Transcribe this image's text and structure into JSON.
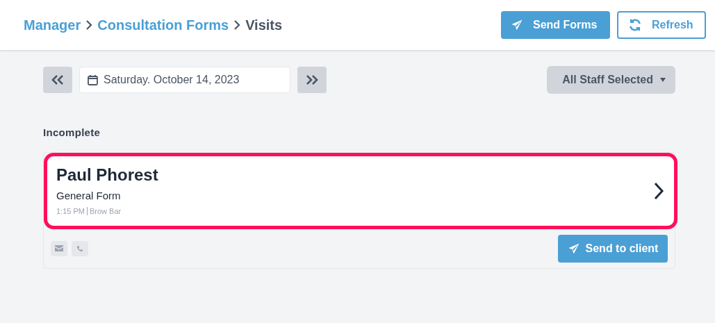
{
  "breadcrumb": [
    {
      "label": "Manager",
      "current": false
    },
    {
      "label": "Consultation Forms",
      "current": false
    },
    {
      "label": "Visits",
      "current": true
    }
  ],
  "header_buttons": [
    {
      "label": "Send Forms",
      "kind": "primary"
    },
    {
      "label": "Refresh",
      "kind": "outline"
    }
  ],
  "date_field": {
    "value": "Saturday. October 14, 2023"
  },
  "staff_dropdown": {
    "value": "All Staff Selected"
  },
  "section": {
    "title": "Incomplete"
  },
  "visits": [
    {
      "client": "Paul Phorest",
      "form": "General Form",
      "time": "1:15 PM",
      "location": "Brow Bar",
      "highlighted": true,
      "send_button": "Send to client"
    }
  ]
}
